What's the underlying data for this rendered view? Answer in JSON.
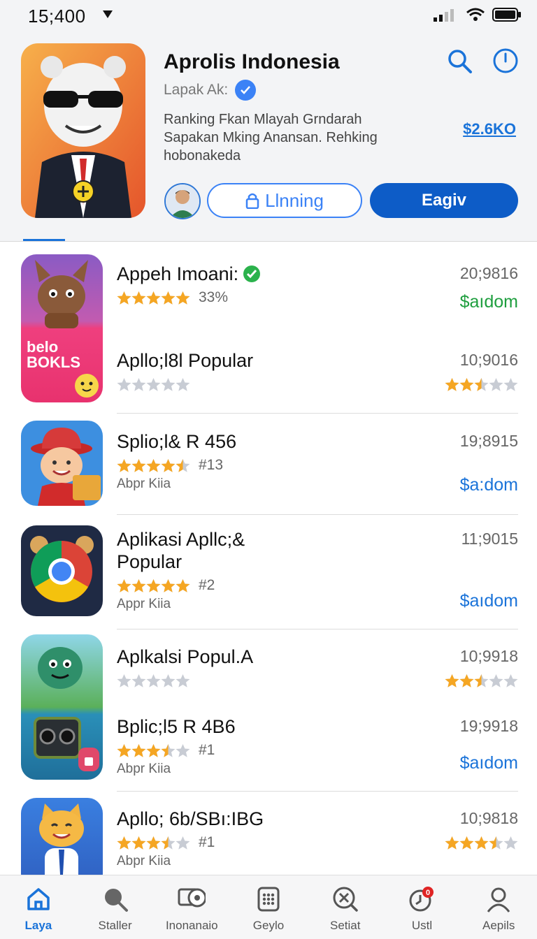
{
  "status": {
    "time": "15;400"
  },
  "header": {
    "title": "Aprolis Indonesia",
    "subtitle": "Lapak Ak:",
    "description": "Ranking Fkan Mlayah Grndarah Sapakan Mking Anansan. Rehking hobonakeda",
    "price": "$2.6KO",
    "outline_button": "Llnning",
    "primary_button": "Eagiv"
  },
  "apps": [
    {
      "name": "Appeh Imoani:",
      "verified": true,
      "date": "20;9816",
      "rating": 5,
      "rank": "33%",
      "price": "$aıdom",
      "price_color": "#1e9e3e"
    },
    {
      "name": "Apllo;l8l Popular",
      "date": "10;9016",
      "rating": 0,
      "right_rating": 2.5
    },
    {
      "name": "Splio;l& R 456",
      "date": "19;8915",
      "rating": 4.5,
      "rank": "#13",
      "developer": "Abpr Kiia",
      "price": "$a:dom",
      "price_color": "#1a73d9"
    },
    {
      "name": "Aplikasi Apllc;&\nPopular",
      "date": "11;9015",
      "rating": 5,
      "rank": "#2",
      "developer": "Appr Kiia",
      "price": "$aıdom",
      "price_color": "#1a73d9"
    },
    {
      "name": "Aplkalsi Popul.A",
      "date": "10;9918",
      "rating": 0,
      "right_rating": 2.5
    },
    {
      "name": "Bplic;l5 R 4B6",
      "date": "19;9918",
      "rating": 3.5,
      "rank": "#1",
      "developer": "Abpr Kiia",
      "price": "$aıdom",
      "price_color": "#1a73d9"
    },
    {
      "name": "Apllo; 6b/SBı:IBG",
      "date": "10;9818",
      "rating": 3.5,
      "rank": "#1",
      "developer": "Abpr Kiia",
      "right_rating": 3.5
    }
  ],
  "icon_labels": {
    "apps_0": "belo BOKLS"
  },
  "nav": [
    {
      "label": "Laya",
      "icon": "home-icon",
      "active": true
    },
    {
      "label": "Staller",
      "icon": "search-icon"
    },
    {
      "label": "Inonanaio",
      "icon": "location-icon"
    },
    {
      "label": "Geylo",
      "icon": "grid-icon"
    },
    {
      "label": "Setiat",
      "icon": "close-circle-icon"
    },
    {
      "label": "Ustl",
      "icon": "clock-badge-icon",
      "badge": "0"
    },
    {
      "label": "Aepils",
      "icon": "person-icon"
    }
  ],
  "colors": {
    "accent": "#1a73d9",
    "primary_button": "#0d5cc7",
    "green_price": "#1e9e3e",
    "star": "#f5a623"
  }
}
